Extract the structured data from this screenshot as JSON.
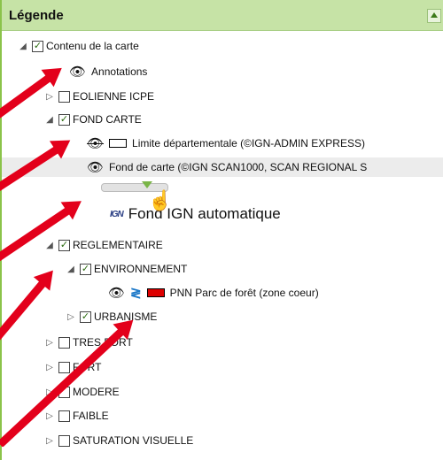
{
  "header": {
    "title": "Légende"
  },
  "tree": {
    "root": "Contenu de la carte",
    "annotations": "Annotations",
    "eolienne": "EOLIENNE ICPE",
    "fond_carte": "FOND CARTE",
    "limite": "Limite départementale (©IGN-ADMIN EXPRESS)",
    "fond_de_carte": "Fond de carte (©IGN SCAN1000, SCAN REGIONAL S",
    "fond_ign": "Fond IGN automatique",
    "reglementaire": "REGLEMENTAIRE",
    "environnement": "ENVIRONNEMENT",
    "pnn": "PNN Parc de forêt (zone coeur)",
    "urbanisme": "URBANISME",
    "tres_fort": "TRES FORT",
    "fort": "FORT",
    "modere": "MODERE",
    "faible": "FAIBLE",
    "saturation": "SATURATION VISUELLE"
  },
  "icons": {
    "ign_logo": "IGN"
  },
  "colors": {
    "header": "#c6e3a6",
    "accent": "#8bc34a",
    "arrow": "#e3001b",
    "pnn_swatch": "#dd0000"
  }
}
